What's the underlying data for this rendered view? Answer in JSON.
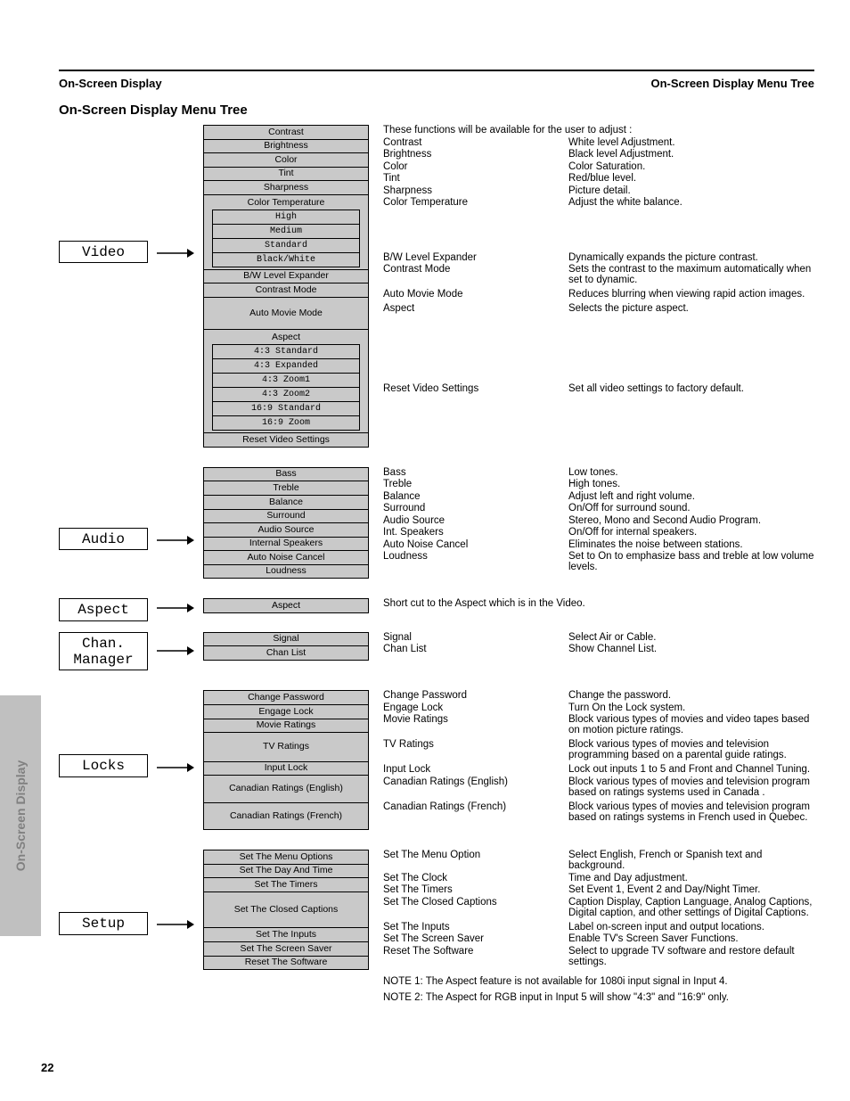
{
  "running_header_left": "On-Screen Display",
  "running_header_right": "On-Screen Display Menu Tree",
  "gutter_tab": "On-Screen Display",
  "tree_heading": "On-Screen Display Menu Tree",
  "page_number": "22",
  "video": {
    "label": "Video",
    "items": [
      "Contrast",
      "Brightness",
      "Color",
      "Tint",
      "Sharpness",
      "Color Temperature",
      "B/W Level Expander",
      "Contrast Mode",
      "Auto Movie Mode",
      "Aspect",
      "Reset Video Settings"
    ],
    "color_temp_children": [
      "High",
      "Medium",
      "Standard",
      "Black/White"
    ],
    "aspect_children": [
      "4:3 Standard",
      "4:3 Expanded",
      "4:3 Zoom1",
      "4:3 Zoom2",
      "16:9 Standard",
      "16:9 Zoom"
    ],
    "intro": "These functions will be available for the user to adjust :",
    "rows": [
      [
        "Contrast",
        "White level Adjustment."
      ],
      [
        "Brightness",
        "Black level Adjustment."
      ],
      [
        "Color",
        "Color Saturation."
      ],
      [
        "Tint",
        "Red/blue level."
      ],
      [
        "Sharpness",
        "Picture detail."
      ],
      [
        "Color Temperature",
        "Adjust the white balance."
      ]
    ],
    "rows2": [
      [
        "B/W Level Expander",
        "Dynamically expands the picture contrast."
      ],
      [
        "Contrast Mode",
        "Sets the contrast to the maximum automatically when set to dynamic."
      ],
      [
        "Auto Movie Mode",
        "Reduces blurring when viewing rapid action images."
      ],
      [
        "Aspect",
        "Selects the picture aspect."
      ]
    ],
    "reset": "Reset Video Settings",
    "reset_desc": "Set all video settings to factory default."
  },
  "audio": {
    "label": "Audio",
    "items": [
      "Bass",
      "Treble",
      "Balance",
      "Surround",
      "Audio Source",
      "Internal Speakers",
      "Auto Noise Cancel",
      "Loudness"
    ],
    "rows": [
      [
        "Bass",
        "Low tones."
      ],
      [
        "Treble",
        "High tones."
      ],
      [
        "Balance",
        "Adjust left and right volume."
      ],
      [
        "Surround",
        "On/Off for surround sound."
      ],
      [
        "Audio Source",
        "Stereo, Mono and Second Audio Program."
      ],
      [
        "Int. Speakers",
        "On/Off for internal speakers."
      ],
      [
        "Auto Noise Cancel",
        "Eliminates the noise between stations."
      ],
      [
        "Loudness",
        "Set to On to emphasize bass and treble at low volume levels."
      ]
    ]
  },
  "aspect": {
    "label": "Aspect",
    "items": [
      "Aspect"
    ],
    "text": "Short cut to the Aspect which is in the Video."
  },
  "chan": {
    "label": "Chan.\nManager",
    "items": [
      "Signal",
      "Chan List"
    ],
    "rows": [
      [
        "Signal",
        "Select Air or Cable."
      ],
      [
        "Chan List",
        "Show Channel List."
      ]
    ]
  },
  "locks": {
    "label": "Locks",
    "items": [
      "Change Password",
      "Engage Lock",
      "Movie Ratings",
      "TV Ratings",
      "Input Lock",
      "Canadian Ratings (English)",
      "Canadian Ratings (French)"
    ],
    "rows": [
      [
        "Change Password",
        "Change the password."
      ],
      [
        "Engage Lock",
        "Turn On the Lock system."
      ],
      [
        "Movie Ratings",
        "Block various types of movies and video tapes based on motion picture ratings."
      ],
      [
        "TV Ratings",
        "Block various types of movies and television programming based on a parental guide ratings."
      ],
      [
        "Input Lock",
        "Lock out inputs 1 to 5 and Front and Channel Tuning."
      ],
      [
        "Canadian Ratings (English)",
        "Block various types of movies and television program based on ratings systems used in Canada ."
      ],
      [
        "Canadian Ratings (French)",
        "Block various types of movies and television program based on ratings systems in French used in Quebec."
      ]
    ]
  },
  "setup": {
    "label": "Setup",
    "items": [
      "Set The Menu Options",
      "Set The Day And Time",
      "Set The Timers",
      "Set The Closed Captions",
      "Set The Inputs",
      "Set The Screen Saver",
      "Reset The Software"
    ],
    "rows": [
      [
        "Set The Menu Option",
        "Select English, French or Spanish text and background."
      ],
      [
        "Set The Clock",
        "Time and Day adjustment."
      ],
      [
        "Set The Timers",
        "Set Event 1, Event 2 and Day/Night Timer."
      ],
      [
        "Set The Closed Captions",
        "Caption Display, Caption Language, Analog Captions, Digital caption, and other settings of Digital Captions."
      ],
      [
        "Set The Inputs",
        "Label on-screen input and output locations."
      ],
      [
        "Set The Screen Saver",
        "Enable TV's Screen Saver Functions."
      ],
      [
        "Reset The Software",
        "Select to upgrade TV software and restore default settings."
      ]
    ],
    "note1": "NOTE 1: The Aspect feature is not available for 1080i input signal in Input 4.",
    "note2": "NOTE 2: The Aspect for RGB input in Input 5 will show \"4:3\" and \"16:9\" only."
  }
}
